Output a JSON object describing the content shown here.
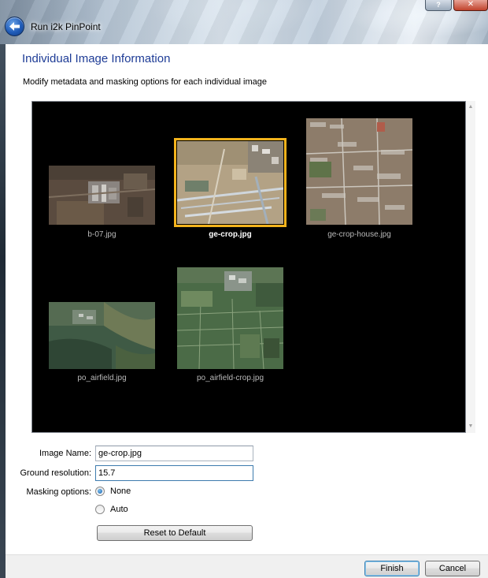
{
  "window": {
    "title": "Run i2k PinPoint",
    "help_label": "?",
    "close_label": "✕",
    "back_icon": "back-arrow-icon"
  },
  "page": {
    "heading": "Individual Image Information",
    "subheading": "Modify metadata and masking options for each individual image"
  },
  "gallery": {
    "selected": "ge-crop.jpg",
    "images": [
      {
        "name": "b-07.jpg"
      },
      {
        "name": "ge-crop.jpg"
      },
      {
        "name": "ge-crop-house.jpg"
      },
      {
        "name": "po_airfield.jpg"
      },
      {
        "name": "po_airfield-crop.jpg"
      }
    ]
  },
  "form": {
    "image_name_label": "Image Name:",
    "image_name_value": "ge-crop.jpg",
    "ground_resolution_label": "Ground resolution:",
    "ground_resolution_value": "15.7",
    "masking_label": "Masking options:",
    "masking_options": [
      "None",
      "Auto"
    ],
    "masking_selected": "None",
    "reset_label": "Reset to Default"
  },
  "buttons": {
    "finish": "Finish",
    "cancel": "Cancel"
  },
  "colors": {
    "heading": "#1e3c96",
    "selection": "#f3b31c",
    "gallery_bg": "#000000"
  }
}
